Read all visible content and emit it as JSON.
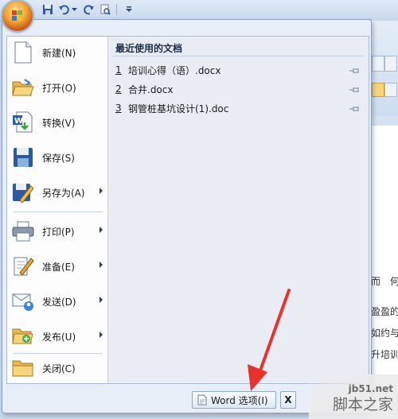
{
  "quick_access": {
    "icons": [
      "save-icon",
      "undo-icon",
      "undo-dropdown-icon",
      "redo-icon",
      "print-preview-icon",
      "customize-qat-icon"
    ]
  },
  "office_menu": {
    "left_items": [
      {
        "label": "新建(N)",
        "icon": "new-document-icon",
        "submenu": false
      },
      {
        "label": "打开(O)",
        "icon": "open-folder-icon",
        "submenu": false
      },
      {
        "label": "转换(V)",
        "icon": "convert-icon",
        "submenu": false
      },
      {
        "label": "保存(S)",
        "icon": "save-disk-icon",
        "submenu": false
      },
      {
        "label": "另存为(A)",
        "icon": "save-as-icon",
        "submenu": true
      },
      {
        "label": "打印(P)",
        "icon": "printer-icon",
        "submenu": true
      },
      {
        "label": "准备(E)",
        "icon": "prepare-icon",
        "submenu": true
      },
      {
        "label": "发送(D)",
        "icon": "send-icon",
        "submenu": true
      },
      {
        "label": "发布(U)",
        "icon": "publish-icon",
        "submenu": true
      },
      {
        "label": "关闭(C)",
        "icon": "close-folder-icon",
        "submenu": false
      }
    ],
    "recent": {
      "title": "最近使用的文档",
      "items": [
        {
          "num": "1",
          "name": "培训心得（语）.docx"
        },
        {
          "num": "2",
          "name": "合井.docx"
        },
        {
          "num": "3",
          "name": "钢管桩基坑设计(1).doc"
        }
      ]
    },
    "buttons": {
      "word_options": "Word 选项(I)",
      "exit": "X"
    }
  },
  "background_document": {
    "lines": [
      "而　何",
      "盈盈的",
      "如约与",
      "升培训"
    ]
  },
  "watermark": {
    "site": "jb51.net",
    "name": "脚本之家"
  },
  "colors": {
    "annotation_arrow": "#e8322d",
    "menu_background": "#e9ecf3"
  }
}
